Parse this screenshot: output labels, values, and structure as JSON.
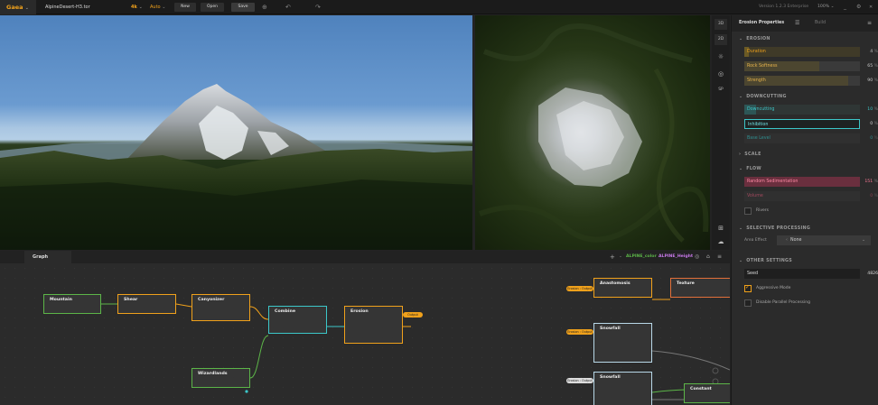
{
  "topbar": {
    "logo": "Gaea",
    "filename": "AlpineDesert-H3.tor",
    "resolution": "4k",
    "auto_label": "Auto",
    "new_label": "New",
    "open_label": "Open",
    "save_label": "Save",
    "version": "Version 1.2.3 Enterprise",
    "zoom": "100%"
  },
  "viewport_tools": [
    "3D",
    "2D",
    "SP"
  ],
  "panel": {
    "tab_props": "Erosion Properties",
    "tab_build": "Build",
    "sections": {
      "erosion": "EROSION",
      "downcutting": "DOWNCUTTING",
      "scale": "SCALE",
      "flow": "FLOW",
      "selective": "SELECTIVE PROCESSING",
      "other": "OTHER SETTINGS"
    },
    "erosion": [
      {
        "label": "Duration",
        "value": "4",
        "unit": "%",
        "fill": 0.04
      },
      {
        "label": "Rock Softness",
        "value": "65",
        "unit": "%",
        "fill": 0.65
      },
      {
        "label": "Strength",
        "value": "90",
        "unit": "%",
        "fill": 0.9
      }
    ],
    "downcutting": [
      {
        "label": "Downcutting",
        "value": "10",
        "unit": "%",
        "fill": 0.1
      },
      {
        "label": "Inhibition",
        "value": "0",
        "unit": "%",
        "fill": 0.0
      },
      {
        "label": "Base Level",
        "value": "0",
        "unit": "%",
        "fill": 0.0
      }
    ],
    "flow": [
      {
        "label": "Random Sedimentation",
        "value": "151",
        "unit": "%",
        "fill": 1.0
      },
      {
        "label": "Volume",
        "value": "0",
        "unit": "%",
        "fill": 0.0
      }
    ],
    "rivers_label": "Rivers",
    "area_effect_label": "Area Effect",
    "area_effect_value": "None",
    "seed_label": "Seed",
    "seed_value": "4826",
    "aggressive_label": "Aggressive Mode",
    "parallel_label": "Disable Parallel Processing"
  },
  "graph": {
    "tab": "Graph",
    "alpine_color": "ALPINE_color",
    "alpine_height": "ALPINE_Height",
    "nodes": {
      "mountain": "Mountain",
      "shear": "Shear",
      "canyonizer": "Canyonizer",
      "combine": "Combine",
      "erosion": "Erosion",
      "wizardlands": "Wizardlands",
      "anastomosis": "Anastomosis",
      "texture": "Texture",
      "snowfall1": "Snowfall",
      "snowfall2": "Snowfall",
      "constant": "Constant"
    },
    "ports": {
      "output": "Output",
      "erosion_output": "Erosion : Output"
    }
  },
  "colors": {
    "accent": "#f0a11b",
    "green": "#5cb548",
    "cyan": "#3cc7c9",
    "pink": "#e85a7a",
    "purple": "#c678e8",
    "white_node": "#d0d0d0"
  }
}
